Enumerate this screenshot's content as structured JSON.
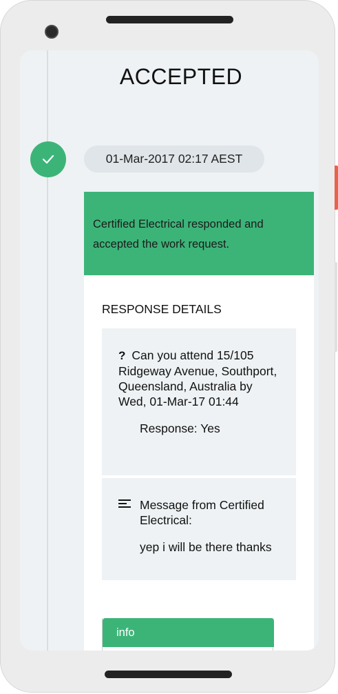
{
  "status": {
    "title": "ACCEPTED"
  },
  "timeline_entry": {
    "icon": "check-icon",
    "timestamp": "01-Mar-2017 02:17 AEST",
    "summary": "Certified Electrical responded and accepted the work request."
  },
  "response_details": {
    "heading": "RESPONSE DETAILS",
    "question_mark": "?",
    "question": "Can you attend 15/105 Ridgeway Avenue, Southport, Queensland, Australia by Wed, 01-Mar-17 01:44",
    "response": "Response: Yes",
    "message_label": "Message from Certified Electrical:",
    "message": "yep i will be there thanks"
  },
  "info_panel": {
    "label": "info"
  },
  "colors": {
    "accent": "#3cb478",
    "background": "#eef2f4",
    "pill": "#dfe5e8"
  }
}
